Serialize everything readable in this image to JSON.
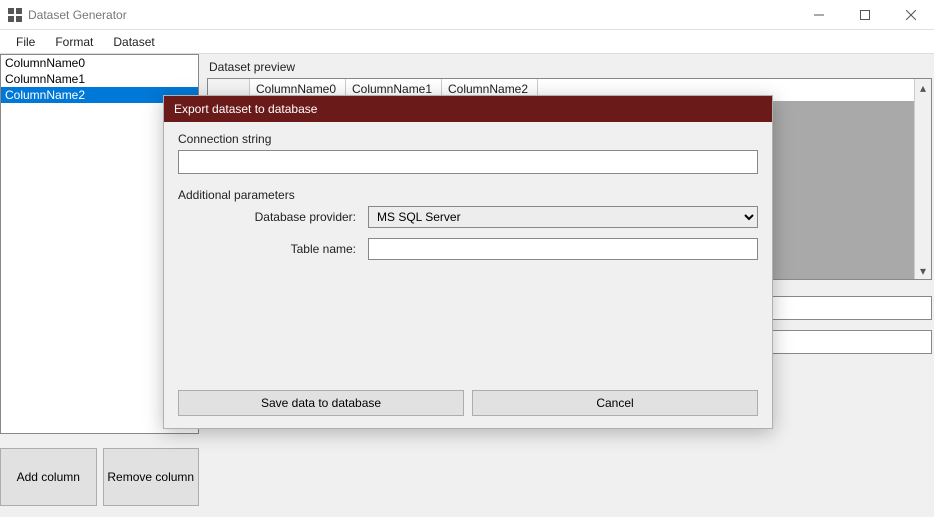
{
  "window": {
    "title": "Dataset Generator",
    "controls": {
      "minimize": "—",
      "maximize": "▢",
      "close": "✕"
    }
  },
  "menu": {
    "items": [
      "File",
      "Format",
      "Dataset"
    ]
  },
  "sidebar": {
    "columns": [
      "ColumnName0",
      "ColumnName1",
      "ColumnName2"
    ],
    "selected_index": 2,
    "add_button": "Add column",
    "remove_button": "Remove column"
  },
  "preview": {
    "label": "Dataset preview",
    "headers": [
      "ColumnName0",
      "ColumnName1",
      "ColumnName2"
    ],
    "active_header_index": 0
  },
  "dialog": {
    "title": "Export dataset to database",
    "conn_label": "Connection string",
    "conn_value": "",
    "additional_label": "Additional parameters",
    "provider_label": "Database provider:",
    "provider_value": "MS SQL Server",
    "table_label": "Table name:",
    "table_value": "",
    "save_button": "Save data to database",
    "cancel_button": "Cancel"
  }
}
